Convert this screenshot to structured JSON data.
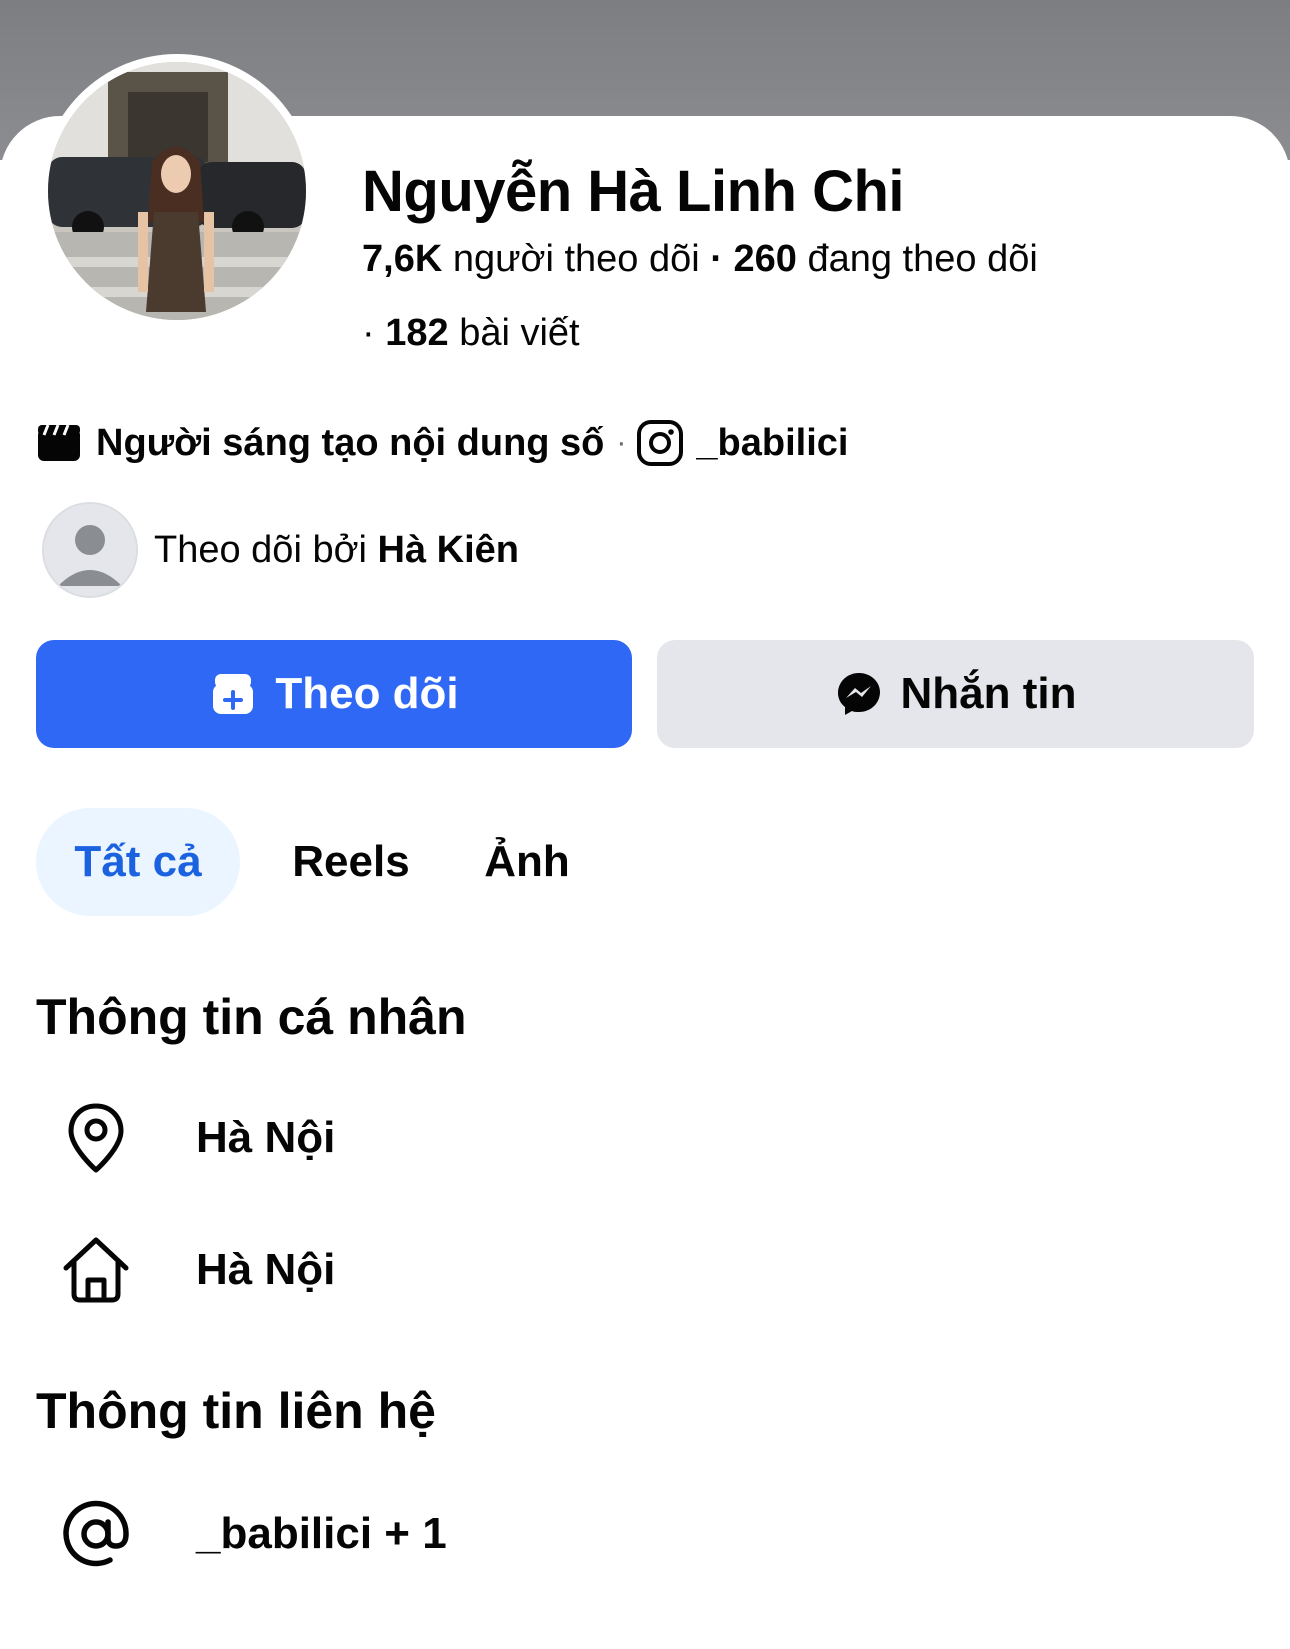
{
  "profile": {
    "name": "Nguyễn Hà Linh Chi",
    "followers_count": "7,6K",
    "followers_label": "người theo dõi",
    "dot": "·",
    "following_count": "260",
    "following_label": "đang theo dõi",
    "posts_prefix": "·",
    "posts_count": "182",
    "posts_label": "bài viết",
    "category": "Người sáng tạo nội dung số",
    "separator": "·",
    "instagram_handle": "_babilici",
    "followed_by_prefix": "Theo dõi bởi",
    "followed_by_name": "Hà Kiên"
  },
  "icons": {
    "category": "clapperboard-icon",
    "instagram": "instagram-icon",
    "follow": "follow-plus-icon",
    "message": "messenger-icon",
    "location": "map-pin-icon",
    "home": "home-icon",
    "email": "at-sign-icon"
  },
  "actions": {
    "follow_label": "Theo dõi",
    "message_label": "Nhắn tin"
  },
  "tabs": [
    {
      "label": "Tất cả",
      "active": true
    },
    {
      "label": "Reels",
      "active": false
    },
    {
      "label": "Ảnh",
      "active": false
    }
  ],
  "personal_info": {
    "title": "Thông tin cá nhân",
    "current_city": "Hà Nội",
    "hometown": "Hà Nội"
  },
  "contact_info": {
    "title": "Thông tin liên hệ",
    "handle": "_babilici + 1"
  },
  "colors": {
    "primary": "#2e68f4",
    "tab_active_bg": "#ebf5ff",
    "tab_active_text": "#1b62e0",
    "secondary_button": "#e4e6eb"
  }
}
